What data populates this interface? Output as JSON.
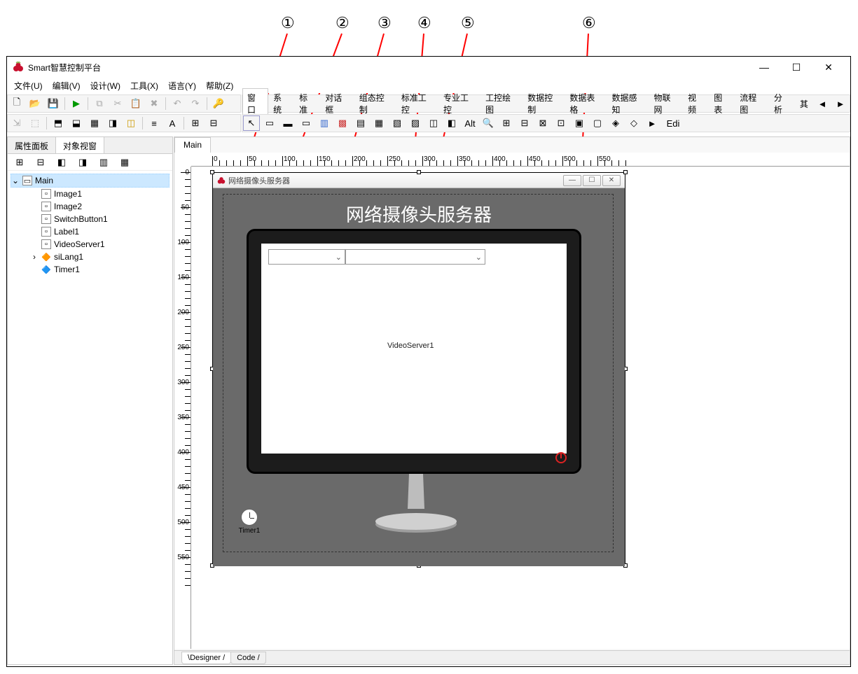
{
  "app": {
    "title": "Smart智慧控制平台"
  },
  "window_controls": {
    "min": "—",
    "max": "☐",
    "close": "✕"
  },
  "menu": {
    "file": "文件(U)",
    "edit": "编辑(V)",
    "design": "设计(W)",
    "tool": "工具(X)",
    "lang": "语言(Y)",
    "help": "帮助(Z)"
  },
  "toolbar_icons": {
    "new": "🗋",
    "open": "📂",
    "save": "💾",
    "run": "▶",
    "copy": "⧉",
    "cut": "✂",
    "paste": "📋",
    "delete": "✖",
    "undo": "↶",
    "redo": "↷",
    "key": "🔑",
    "align1": "⇲",
    "align2": "⬚",
    "grp1": "⬒",
    "grp2": "⬓",
    "grp3": "▦",
    "grp4": "◨",
    "grp5": "◫",
    "list": "≡",
    "text": "A",
    "boxa": "⊞",
    "boxb": "⊟"
  },
  "component_tabs": [
    "窗口",
    "系统",
    "标准",
    "对话框",
    "组态控制",
    "标准工控",
    "专业工控",
    "工控绘图",
    "数据控制",
    "数据表格",
    "数据感知",
    "物联网",
    "视频",
    "图表",
    "流程图",
    "分析",
    "其"
  ],
  "component_icons": [
    "▭",
    "▬",
    "▭",
    "▥",
    "▩",
    "▤",
    "▦",
    "▧",
    "▨",
    "◫",
    "◧",
    "◨",
    "◩",
    "◪",
    "⊞",
    "⊟",
    "⊠",
    "⊡",
    "▣",
    "▢",
    "◈",
    "◇",
    "◆",
    "▲",
    "►",
    "Edi"
  ],
  "left_tabs": {
    "prop": "属性面板",
    "obj": "对象视窗"
  },
  "left_tb_icons": [
    "⊞",
    "⊟",
    "◧",
    "◨",
    "▥",
    "▦"
  ],
  "tree": {
    "root": "Main",
    "items": [
      "Image1",
      "Image2",
      "SwitchButton1",
      "Label1",
      "VideoServer1",
      "siLang1",
      "Timer1"
    ]
  },
  "main_tab": "Main",
  "ruler_marks_h": [
    "0",
    "50",
    "100",
    "150",
    "200",
    "250",
    "300",
    "350",
    "400",
    "450",
    "500",
    "550"
  ],
  "ruler_marks_v": [
    "0",
    "50",
    "100",
    "150",
    "200",
    "250",
    "300",
    "350",
    "400",
    "450",
    "500",
    "550"
  ],
  "form": {
    "title": "网络摄像头服务器",
    "heading": "网络摄像头服务器",
    "videoserver_label": "VideoServer1",
    "timer_label": "Timer1",
    "combo_arrow": "⌄"
  },
  "bottom_tabs": {
    "designer": "Designer",
    "code": "Code"
  },
  "annotations": {
    "n1": "①",
    "n2": "②",
    "n3": "③",
    "n4": "④",
    "n5": "⑤",
    "n6": "⑥"
  }
}
